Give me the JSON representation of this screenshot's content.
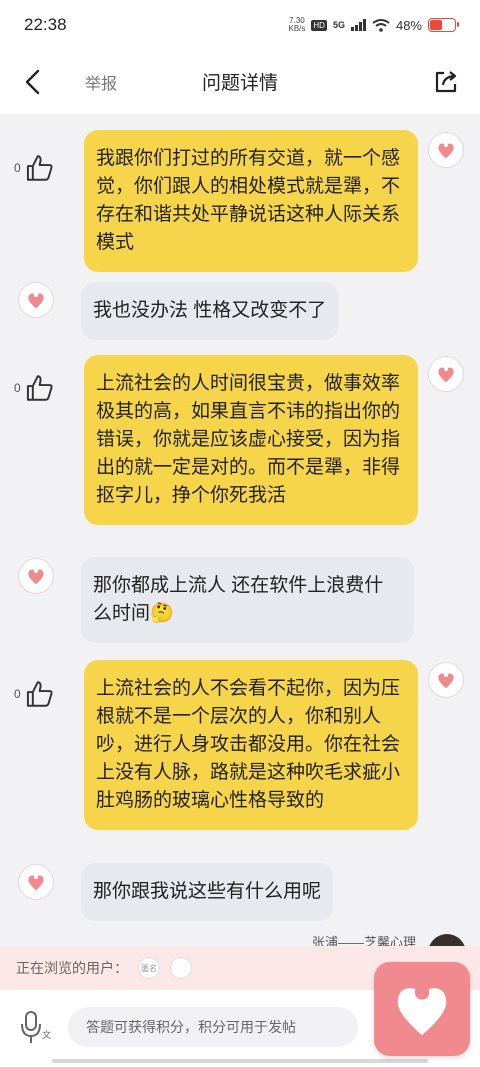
{
  "status_bar": {
    "time": "22:38",
    "net_speed_value": "7.30",
    "net_speed_unit": "KB/s",
    "hd": "HD",
    "network": "5G",
    "battery": "48%",
    "battery_level": 0.48,
    "battery_color": "#e64b3c"
  },
  "nav": {
    "back_icon": "chevron-left-icon",
    "report_label": "举报",
    "title": "问题详情",
    "share_icon": "share-icon"
  },
  "messages": [
    {
      "side": "right",
      "text": "我跟你们打过的所有交道，就一个感觉，你们跟人的相处模式就是犟，不存在和谐共处平静说话这种人际关系模式",
      "like_count": "0"
    },
    {
      "side": "left",
      "text": "我也没办法 性格又改变不了"
    },
    {
      "side": "right",
      "text": "上流社会的人时间很宝贵，做事效率极其的高，如果直言不讳的指出你的错误，你就是应该虚心接受，因为指出的就一定是对的。而不是犟，非得抠字儿，挣个你死我活",
      "like_count": "0"
    },
    {
      "side": "left",
      "text": "那你都成上流人 还在软件上浪费什么时间🤔"
    },
    {
      "side": "right",
      "text": "上流社会的人不会看不起你，因为压根就不是一个层次的人，你和别人吵，进行人身攻击都没用。你在社会上没有人脉，路就是这种吹毛求疵小肚鸡肠的玻璃心性格导致的",
      "like_count": "0"
    },
    {
      "side": "left",
      "text": "那你跟我说这些有什么用呢"
    }
  ],
  "author_tag": "张浦——芝馨心理",
  "viewers": {
    "label": "正在浏览的用户：",
    "chip_1": "匿名"
  },
  "input": {
    "placeholder": "答题可获得积分，积分可用于发帖",
    "mic_icon": "microphone-icon"
  },
  "colors": {
    "right_bubble": "#f7d54a",
    "left_bubble": "#e8e8ef",
    "heart": "#f08a8e",
    "viewers_bg": "#fde8e8"
  }
}
